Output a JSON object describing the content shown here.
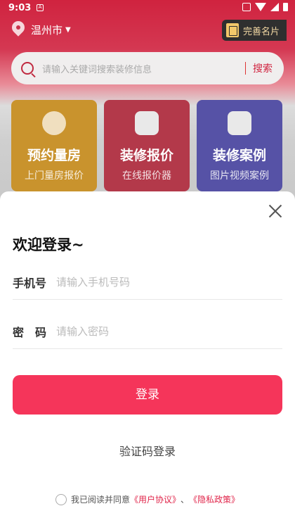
{
  "status_bar": {
    "time": "9:03",
    "notif_letter": "A"
  },
  "location": {
    "city": "温州市",
    "caret": "▼"
  },
  "card_button": {
    "label": "完善名片"
  },
  "search": {
    "placeholder": "请输入关键词搜索装修信息",
    "button": "搜索"
  },
  "tiles": [
    {
      "title": "预约量房",
      "subtitle": "上门量房报价",
      "icon": "tape-measure-icon"
    },
    {
      "title": "装修报价",
      "subtitle": "在线报价器",
      "icon": "calculator-icon"
    },
    {
      "title": "装修案例",
      "subtitle": "图片视频案例",
      "icon": "image-icon"
    }
  ],
  "login": {
    "welcome": "欢迎登录~",
    "phone_label": "手机号",
    "phone_placeholder": "请输入手机号码",
    "password_label": "密　码",
    "password_placeholder": "请输入密码",
    "login_button": "登录",
    "sms_login": "验证码登录",
    "agreement_prefix": "我已阅读并同意",
    "user_agreement": "《用户协议》",
    "separator": "、",
    "privacy_policy": "《隐私政策》"
  },
  "colors": {
    "brand_red": "#d0233f",
    "login_button": "#f5355a",
    "link": "#e0254a"
  }
}
